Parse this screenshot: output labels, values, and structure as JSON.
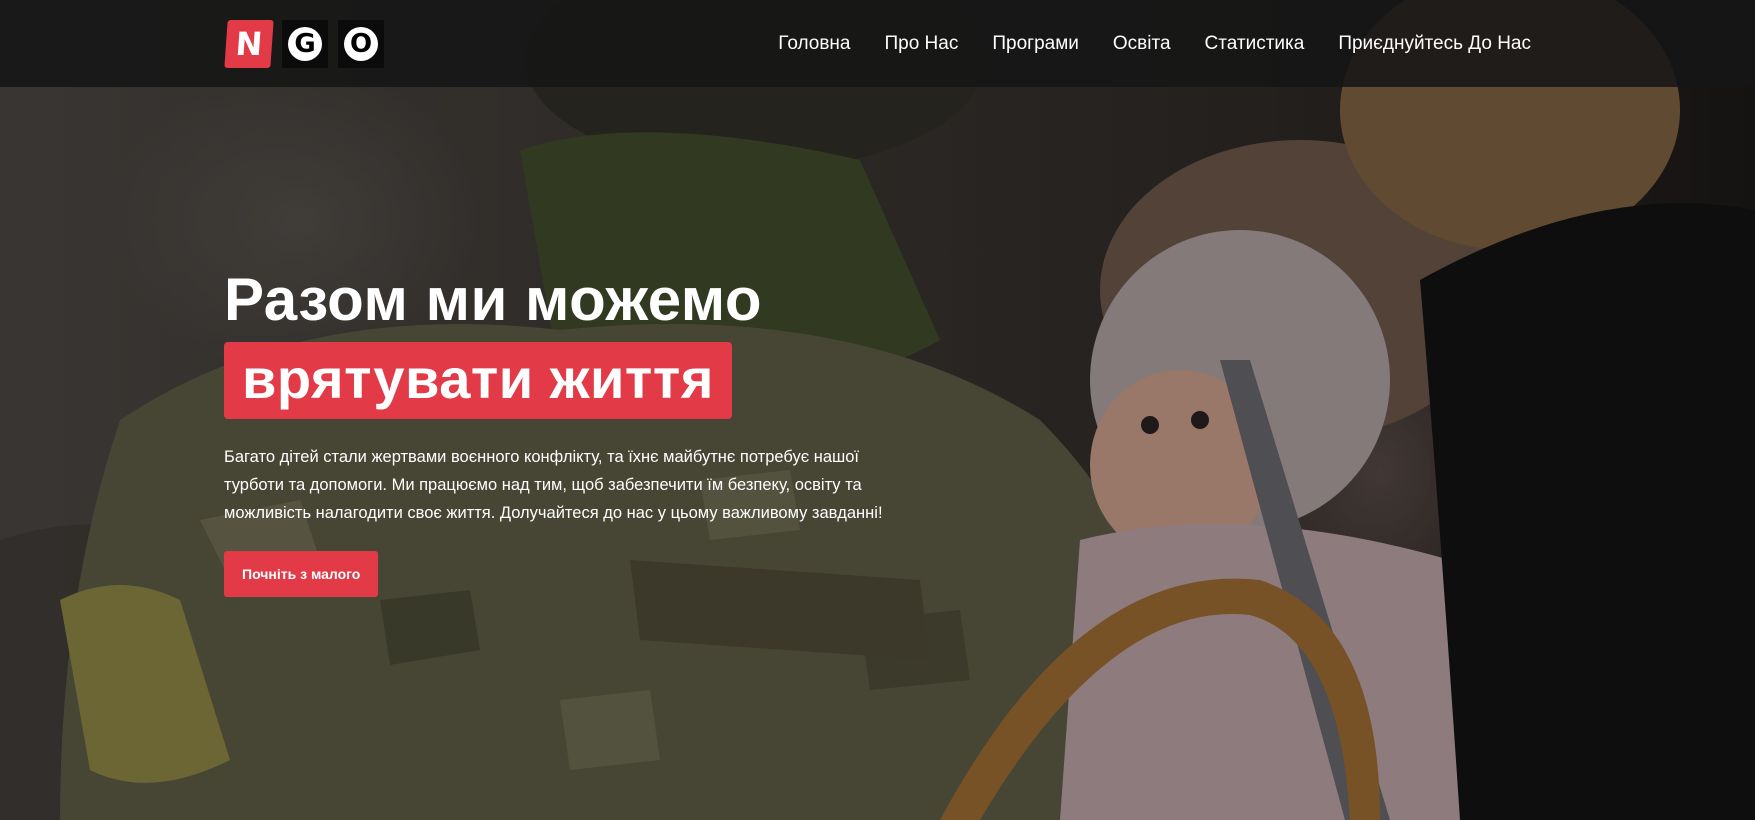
{
  "logo": {
    "letters": [
      "N",
      "G",
      "O"
    ]
  },
  "nav": {
    "items": [
      {
        "label": "Головна"
      },
      {
        "label": "Про Нас"
      },
      {
        "label": "Програми"
      },
      {
        "label": "Освіта"
      },
      {
        "label": "Статистика"
      },
      {
        "label": "Приєднуйтесь До Нас"
      }
    ]
  },
  "hero": {
    "headline_line1": "Разом ми можемо",
    "headline_highlight": "врятувати життя",
    "description": "Багато дітей стали жертвами воєнного конфлікту, та їхнє майбутнє потребує нашої турботи та допомоги. Ми працюємо над тим, щоб забезпечити їм безпеку, освіту та можливість налагодити своє життя. Долучайтеся до нас у цьому важливому завданні!",
    "cta_label": "Почніть з малого"
  },
  "colors": {
    "accent": "#e33a48",
    "navbar_bg": "#161616",
    "text": "#ffffff"
  },
  "background_image": "soldier-carrying-child-photo"
}
